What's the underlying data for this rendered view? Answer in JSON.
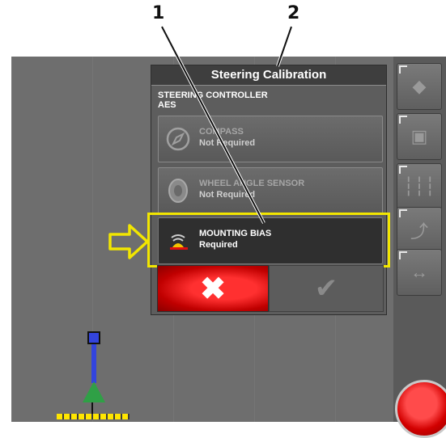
{
  "callouts": {
    "one": "1",
    "two": "2"
  },
  "dialog": {
    "title": "Steering Calibration",
    "controller_label": "STEERING CONTROLLER",
    "controller_value": "AES",
    "steps": [
      {
        "name": "COMPASS",
        "status": "Not Required",
        "icon": "compass-icon",
        "state": "disabled"
      },
      {
        "name": "WHEEL ANGLE SENSOR",
        "status": "Not Required",
        "icon": "wheel-sensor-icon",
        "state": "disabled"
      },
      {
        "name": "MOUNTING BIAS",
        "status": "Required",
        "icon": "mounting-bias-icon",
        "state": "active"
      }
    ],
    "cancel_icon": "close-icon",
    "confirm_icon": "checkmark-icon"
  },
  "toolbar": {
    "icons": [
      "map-icon",
      "field-icon",
      "guidance-lines-icon",
      "steering-icon",
      "split-icon"
    ]
  },
  "colors": {
    "highlight": "#f2e600",
    "cancel": "#d40000",
    "vehicle": "#3344dd",
    "implement": "#ffe600"
  }
}
